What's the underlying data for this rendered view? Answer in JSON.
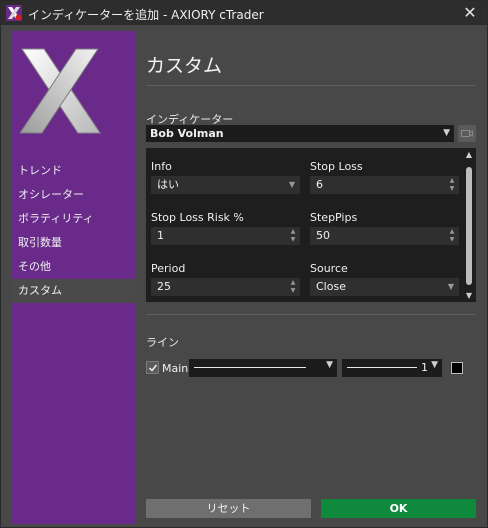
{
  "window": {
    "title": "インディケーターを追加 - AXIORY cTrader",
    "close_symbol": "✕"
  },
  "sidebar": {
    "items": [
      {
        "label": "トレンド"
      },
      {
        "label": "オシレーター"
      },
      {
        "label": "ボラティリティ"
      },
      {
        "label": "取引数量"
      },
      {
        "label": "その他"
      },
      {
        "label": "カスタム",
        "active": true
      }
    ]
  },
  "main": {
    "title": "カスタム",
    "indicator_label": "インディケーター",
    "indicator_value": "Bob Volman",
    "params": {
      "info_label": "Info",
      "info_value": "はい",
      "stop_loss_label": "Stop Loss",
      "stop_loss_value": "6",
      "stop_loss_risk_label": "Stop Loss Risk %",
      "stop_loss_risk_value": "1",
      "step_pips_label": "StepPips",
      "step_pips_value": "50",
      "period_label": "Period",
      "period_value": "25",
      "source_label": "Source",
      "source_value": "Close"
    },
    "lines_label": "ライン",
    "line_main_label": "Main",
    "line_main_checked": true,
    "line_thickness_value": "1",
    "line_color": "#000000"
  },
  "buttons": {
    "reset_label": "リセット",
    "ok_label": "OK"
  },
  "colors": {
    "sidebar_bg": "#6a2a8a",
    "ok_bg": "#0f8a3d",
    "panel_bg": "#484848"
  }
}
